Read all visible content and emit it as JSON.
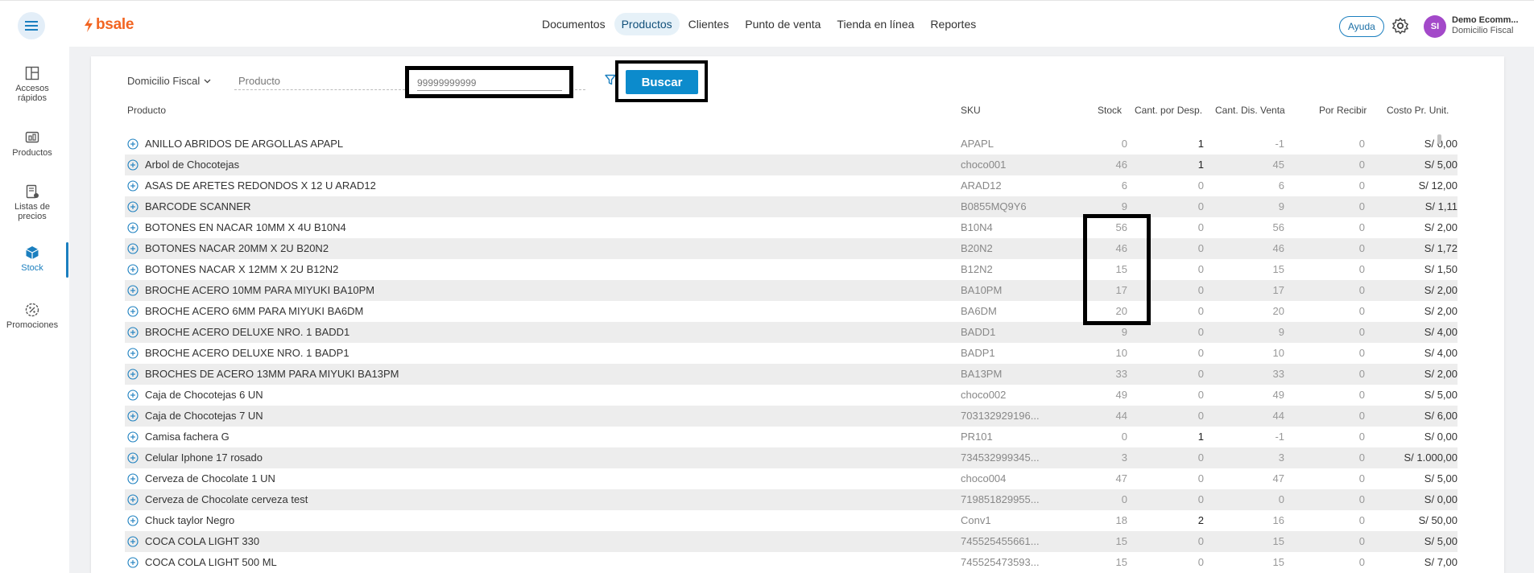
{
  "header": {
    "logo_text": "bsale",
    "nav": [
      {
        "label": "Documentos",
        "active": false
      },
      {
        "label": "Productos",
        "active": true
      },
      {
        "label": "Clientes",
        "active": false
      },
      {
        "label": "Punto de venta",
        "active": false
      },
      {
        "label": "Tienda en línea",
        "active": false
      },
      {
        "label": "Reportes",
        "active": false
      }
    ],
    "help_label": "Ayuda",
    "avatar_initials": "SI",
    "user_name": "Demo Ecomm...",
    "user_sub": "Domicilio Fiscal"
  },
  "sidebar": {
    "items": [
      {
        "label": "Accesos rápidos",
        "icon": "layout-icon"
      },
      {
        "label": "Productos",
        "icon": "products-icon"
      },
      {
        "label": "Listas de precios",
        "icon": "price-list-icon"
      },
      {
        "label": "Stock",
        "icon": "stock-box-icon"
      },
      {
        "label": "Promociones",
        "icon": "promo-icon"
      }
    ],
    "active": "Stock"
  },
  "filters": {
    "location_label": "Domicilio Fiscal",
    "product_placeholder": "Producto",
    "code_value": "99999999999",
    "search_label": "Buscar"
  },
  "table": {
    "headers": {
      "product": "Producto",
      "sku": "SKU",
      "stock": "Stock",
      "desp": "Cant. por Desp.",
      "venta": "Cant. Dis. Venta",
      "recibir": "Por Recibir",
      "costo": "Costo Pr. Unit."
    },
    "rows": [
      {
        "name": "ANILLO ABRIDOS DE ARGOLLAS APAPL",
        "sku": "APAPL",
        "stock": "0",
        "desp": "1",
        "venta": "-1",
        "recibir": "0",
        "costo": "S/ 0,00"
      },
      {
        "name": "Arbol de Chocotejas",
        "sku": "choco001",
        "stock": "46",
        "desp": "1",
        "venta": "45",
        "recibir": "0",
        "costo": "S/ 5,00"
      },
      {
        "name": "ASAS DE ARETES REDONDOS X 12 U ARAD12",
        "sku": "ARAD12",
        "stock": "6",
        "desp": "0",
        "venta": "6",
        "recibir": "0",
        "costo": "S/ 12,00"
      },
      {
        "name": "BARCODE SCANNER",
        "sku": "B0855MQ9Y6",
        "stock": "9",
        "desp": "0",
        "venta": "9",
        "recibir": "0",
        "costo": "S/ 1,11"
      },
      {
        "name": "BOTONES EN NACAR 10MM X 4U B10N4",
        "sku": "B10N4",
        "stock": "56",
        "desp": "0",
        "venta": "56",
        "recibir": "0",
        "costo": "S/ 2,00"
      },
      {
        "name": "BOTONES NACAR 20MM X 2U B20N2",
        "sku": "B20N2",
        "stock": "46",
        "desp": "0",
        "venta": "46",
        "recibir": "0",
        "costo": "S/ 1,72"
      },
      {
        "name": "BOTONES NACAR X 12MM X 2U B12N2",
        "sku": "B12N2",
        "stock": "15",
        "desp": "0",
        "venta": "15",
        "recibir": "0",
        "costo": "S/ 1,50"
      },
      {
        "name": "BROCHE ACERO 10MM PARA MIYUKI BA10PM",
        "sku": "BA10PM",
        "stock": "17",
        "desp": "0",
        "venta": "17",
        "recibir": "0",
        "costo": "S/ 2,00"
      },
      {
        "name": "BROCHE ACERO 6MM PARA MIYUKI BA6DM",
        "sku": "BA6DM",
        "stock": "20",
        "desp": "0",
        "venta": "20",
        "recibir": "0",
        "costo": "S/ 2,00"
      },
      {
        "name": "BROCHE ACERO DELUXE NRO. 1 BADD1",
        "sku": "BADD1",
        "stock": "9",
        "desp": "0",
        "venta": "9",
        "recibir": "0",
        "costo": "S/ 4,00"
      },
      {
        "name": "BROCHE ACERO DELUXE NRO. 1 BADP1",
        "sku": "BADP1",
        "stock": "10",
        "desp": "0",
        "venta": "10",
        "recibir": "0",
        "costo": "S/ 4,00"
      },
      {
        "name": "BROCHES DE ACERO 13MM PARA MIYUKI BA13PM",
        "sku": "BA13PM",
        "stock": "33",
        "desp": "0",
        "venta": "33",
        "recibir": "0",
        "costo": "S/ 2,00"
      },
      {
        "name": "Caja de Chocotejas 6 UN",
        "sku": "choco002",
        "stock": "49",
        "desp": "0",
        "venta": "49",
        "recibir": "0",
        "costo": "S/ 5,00"
      },
      {
        "name": "Caja de Chocotejas 7 UN",
        "sku": "703132929196...",
        "stock": "44",
        "desp": "0",
        "venta": "44",
        "recibir": "0",
        "costo": "S/ 6,00"
      },
      {
        "name": "Camisa fachera G",
        "sku": "PR101",
        "stock": "0",
        "desp": "1",
        "venta": "-1",
        "recibir": "0",
        "costo": "S/ 0,00"
      },
      {
        "name": "Celular Iphone 17 rosado",
        "sku": "734532999345...",
        "stock": "3",
        "desp": "0",
        "venta": "3",
        "recibir": "0",
        "costo": "S/ 1.000,00"
      },
      {
        "name": "Cerveza de Chocolate 1 UN",
        "sku": "choco004",
        "stock": "47",
        "desp": "0",
        "venta": "47",
        "recibir": "0",
        "costo": "S/ 5,00"
      },
      {
        "name": "Cerveza de Chocolate cerveza test",
        "sku": "719851829955...",
        "stock": "0",
        "desp": "0",
        "venta": "0",
        "recibir": "0",
        "costo": "S/ 0,00"
      },
      {
        "name": "Chuck taylor Negro",
        "sku": "Conv1",
        "stock": "18",
        "desp": "2",
        "venta": "16",
        "recibir": "0",
        "costo": "S/ 50,00"
      },
      {
        "name": "COCA COLA LIGHT 330",
        "sku": "745525455661...",
        "stock": "15",
        "desp": "0",
        "venta": "15",
        "recibir": "0",
        "costo": "S/ 5,00"
      },
      {
        "name": "COCA COLA LIGHT 500 ML",
        "sku": "745525473593...",
        "stock": "15",
        "desp": "0",
        "venta": "15",
        "recibir": "0",
        "costo": "S/ 7,00"
      }
    ]
  },
  "colors": {
    "brand_orange": "#f26522",
    "primary_blue": "#0c8bcc",
    "avatar_purple": "#a349c9",
    "row_alt": "#ededed"
  }
}
